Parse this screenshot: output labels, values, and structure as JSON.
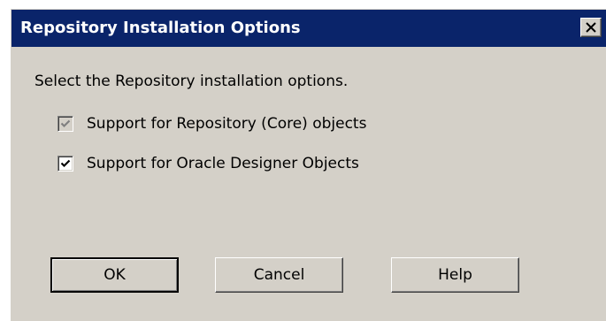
{
  "dialog": {
    "title": "Repository Installation Options",
    "prompt": "Select the Repository installation options.",
    "options": [
      {
        "label": "Support for Repository (Core) objects",
        "checked": true,
        "enabled": false
      },
      {
        "label": "Support for Oracle Designer Objects",
        "checked": true,
        "enabled": true
      }
    ],
    "buttons": {
      "ok": "OK",
      "cancel": "Cancel",
      "help": "Help"
    },
    "colors": {
      "titlebar": "#0a246a",
      "face": "#d4d0c8"
    },
    "icons": {
      "close": "close-icon",
      "check": "checkmark-icon"
    }
  }
}
